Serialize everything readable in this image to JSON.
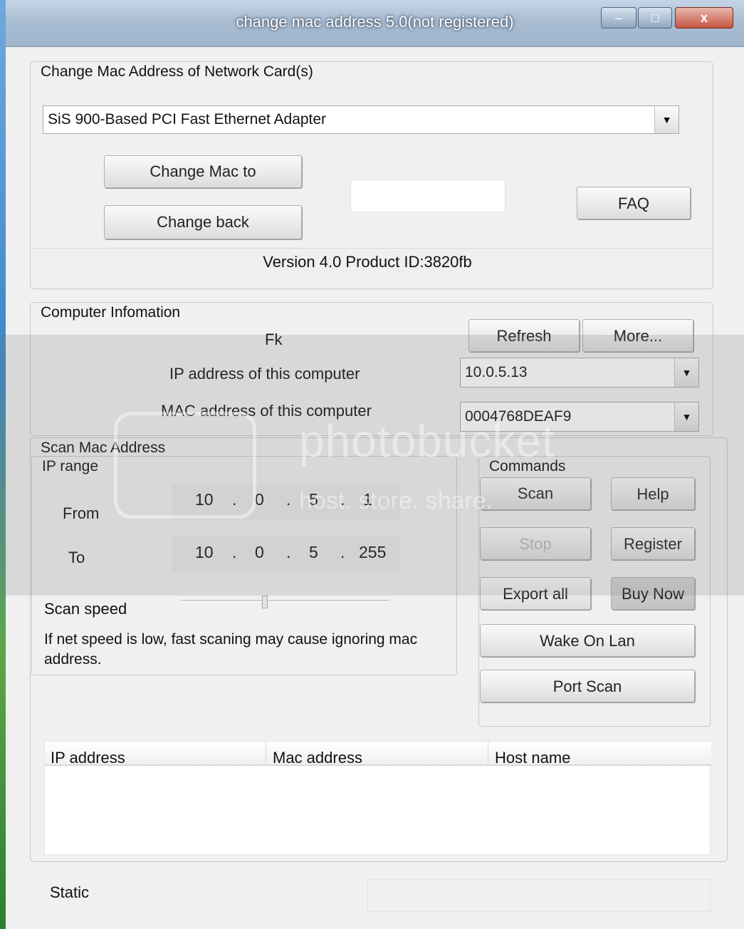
{
  "window": {
    "title": "change mac address 5.0(not registered)",
    "minimize_glyph": "–",
    "maximize_glyph": "□",
    "close_glyph": "x"
  },
  "change_group": {
    "label": "Change Mac Address of Network Card(s)",
    "adapter_selected": "SiS 900-Based PCI Fast Ethernet Adapter",
    "change_mac_button": "Change Mac to",
    "change_back_button": "Change back",
    "mac_input_value": "",
    "faq_button": "FAQ",
    "version_text": "Version 4.0  Product ID:3820fb"
  },
  "computer_info": {
    "label": "Computer Infomation",
    "computer_name": "Fk",
    "refresh_button": "Refresh",
    "more_button": "More...",
    "ip_label": "IP address of this computer",
    "ip_value": "10.0.5.13",
    "mac_label": "MAC address of this computer",
    "mac_value": "0004768DEAF9"
  },
  "scan": {
    "label": "Scan Mac Address",
    "ip_range_label": "IP range",
    "from_label": "From",
    "to_label": "To",
    "from_ip": [
      "10",
      "0",
      "5",
      "1"
    ],
    "to_ip": [
      "10",
      "0",
      "5",
      "255"
    ],
    "dot": ".",
    "scan_speed_label": "Scan speed",
    "scan_speed_level": 0.4,
    "note": "If net speed is low,  fast scaning may cause ignoring mac address."
  },
  "commands": {
    "label": "Commands",
    "scan": "Scan",
    "help": "Help",
    "stop": "Stop",
    "register": "Register",
    "export_all": "Export all",
    "buy_now": "Buy Now",
    "wake_on_lan": "Wake On Lan",
    "port_scan": "Port Scan"
  },
  "results": {
    "columns": [
      "IP address",
      "Mac address",
      "Host name"
    ],
    "rows": []
  },
  "status": {
    "label": "Static",
    "value": ""
  },
  "watermark": {
    "text": "photobucket",
    "subtext": "host. store. share."
  },
  "icons": {
    "dropdown": "chevron-down-icon",
    "slider": "slider-thumb"
  }
}
